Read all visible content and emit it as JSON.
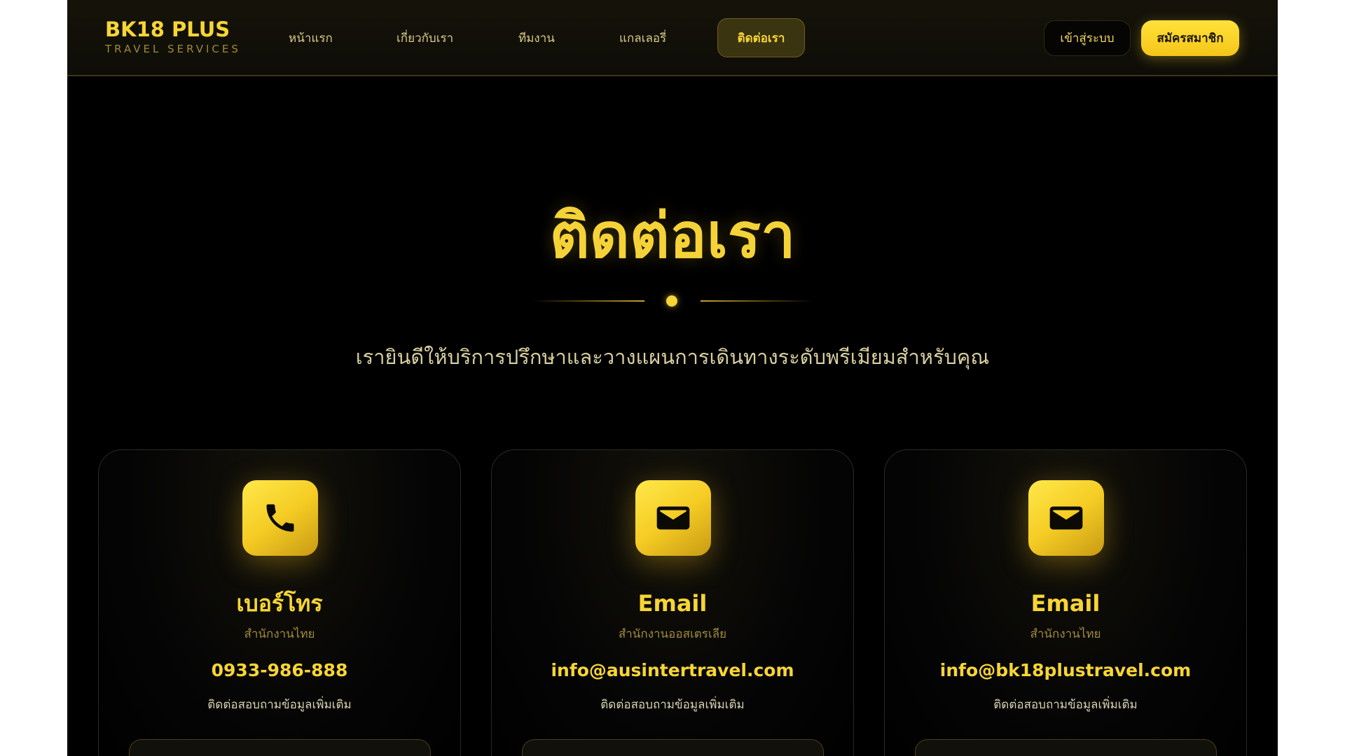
{
  "brand": {
    "name": "BK18 PLUS",
    "tagline": "TRAVEL SERVICES"
  },
  "nav": {
    "items": [
      {
        "label": "หน้าแรก"
      },
      {
        "label": "เกี่ยวกับเรา"
      },
      {
        "label": "ทีมงาน"
      },
      {
        "label": "แกลเลอรี่"
      },
      {
        "label": "ติดต่อเรา"
      }
    ],
    "login_label": "เข้าสู่ระบบ",
    "signup_label": "สมัครสมาชิก"
  },
  "hero": {
    "title": "ติดต่อเรา",
    "subtitle": "เรายินดีให้บริการปรึกษาและวางแผนการเดินทางระดับพรีเมียมสำหรับคุณ"
  },
  "cards": [
    {
      "icon": "phone-icon",
      "title": "เบอร์โทร",
      "office": "สำนักงานไทย",
      "contact": "0933-986-888",
      "note": "ติดต่อสอบถามข้อมูลเพิ่มเติม"
    },
    {
      "icon": "mail-icon",
      "title": "Email",
      "office": "สำนักงานออสเตรเลีย",
      "contact": "info@ausintertravel.com",
      "note": "ติดต่อสอบถามข้อมูลเพิ่มเติม"
    },
    {
      "icon": "mail-icon",
      "title": "Email",
      "office": "สำนักงานไทย",
      "contact": "info@bk18plustravel.com",
      "note": "ติดต่อสอบถามข้อมูลเพิ่มเติม"
    }
  ],
  "colors": {
    "accent": "#f7d534",
    "background": "#000000",
    "muted_gold": "#a08a3a"
  }
}
